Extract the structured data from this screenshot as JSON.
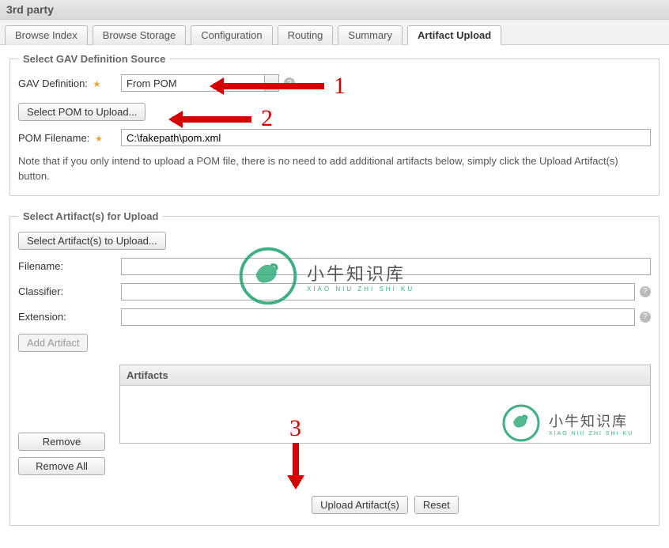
{
  "header": {
    "title": "3rd party"
  },
  "tabs": [
    {
      "label": "Browse Index",
      "active": false
    },
    {
      "label": "Browse Storage",
      "active": false
    },
    {
      "label": "Configuration",
      "active": false
    },
    {
      "label": "Routing",
      "active": false
    },
    {
      "label": "Summary",
      "active": false
    },
    {
      "label": "Artifact Upload",
      "active": true
    }
  ],
  "gav_section": {
    "legend": "Select GAV Definition Source",
    "gav_def_label": "GAV Definition:",
    "gav_def_value": "From POM",
    "select_pom_button": "Select POM to Upload...",
    "pom_filename_label": "POM Filename:",
    "pom_filename_value": "C:\\fakepath\\pom.xml",
    "note": "Note that if you only intend to upload a POM file, there is no need to add additional artifacts below, simply click the Upload Artifact(s) button."
  },
  "artifact_section": {
    "legend": "Select Artifact(s) for Upload",
    "select_button": "Select Artifact(s) to Upload...",
    "filename_label": "Filename:",
    "filename_value": "",
    "classifier_label": "Classifier:",
    "classifier_value": "",
    "extension_label": "Extension:",
    "extension_value": "",
    "add_button": "Add Artifact",
    "artifacts_header": "Artifacts",
    "remove_button": "Remove",
    "remove_all_button": "Remove All",
    "upload_button": "Upload Artifact(s)",
    "reset_button": "Reset"
  },
  "annotations": {
    "n1": "1",
    "n2": "2",
    "n3": "3"
  },
  "watermark": {
    "cn": "小牛知识库",
    "en": "XIAO NIU ZHI SHI KU"
  }
}
